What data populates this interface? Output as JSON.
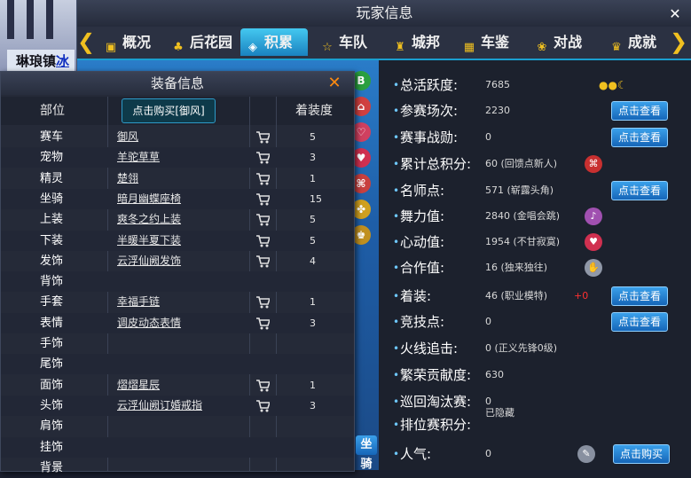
{
  "background": {
    "town_name": "琳琅镇",
    "town_link": "冰"
  },
  "window": {
    "title": "玩家信息",
    "close_glyph": "✕",
    "tabs": [
      {
        "label": "概况",
        "icon": "id-card-icon"
      },
      {
        "label": "后花园",
        "icon": "garden-icon"
      },
      {
        "label": "积累",
        "icon": "layers-icon"
      },
      {
        "label": "车队",
        "icon": "star-icon"
      },
      {
        "label": "城邦",
        "icon": "castle-icon"
      },
      {
        "label": "车鉴",
        "icon": "car-icon"
      },
      {
        "label": "对战",
        "icon": "paw-icon"
      },
      {
        "label": "成就",
        "icon": "medal-icon"
      }
    ],
    "active_tab": "积累",
    "prev_arrow": "❮",
    "next_arrow": "❯"
  },
  "stats": [
    {
      "label": "总活跃度:",
      "value": "7685",
      "extra": "sun-moon-icon"
    },
    {
      "label": "参赛场次:",
      "value": "2230",
      "button": "点击查看"
    },
    {
      "label": "赛事战勋:",
      "value": "0",
      "button": "点击查看"
    },
    {
      "label": "累计总积分:",
      "value": "60 (回馈点新人)",
      "extra": "gift-icon"
    },
    {
      "label": "名师点:",
      "value": "571 (崭露头角)",
      "button": "点击查看"
    },
    {
      "label": "舞力值:",
      "value": "2840 (金唱会跳)",
      "extra": "dance-icon"
    },
    {
      "label": "心动值:",
      "value": "1954 (不甘寂寞)",
      "extra": "heart-icon"
    },
    {
      "label": "合作值:",
      "value": "16 (独来独往)",
      "extra": "handshake-icon"
    },
    {
      "label": "着装:",
      "value": "46 (职业模特)",
      "plus": "+0",
      "button": "点击查看"
    },
    {
      "label": "竞技点:",
      "value": "0",
      "button": "点击查看"
    },
    {
      "label": "火线追击:",
      "value": "0 (正义先锋0级)"
    },
    {
      "label": "繁荣贡献度:",
      "value": "630"
    },
    {
      "label": "巡回淘汰赛:",
      "value": "0"
    },
    {
      "label": "排位赛积分:",
      "value": "已隐藏"
    },
    {
      "label": "人气:",
      "value": "0",
      "extra": "popularity-icon",
      "button": "点击购买"
    }
  ],
  "equipment": {
    "title": "装备信息",
    "close_glyph": "✕",
    "col_slot": "部位",
    "buy_button": "点击购买[御风]",
    "col_count": "着装度",
    "side_button_fragment": "坐骑",
    "rows": [
      {
        "slot": "赛车",
        "item": "御风",
        "count": "5"
      },
      {
        "slot": "宠物",
        "item": "羊驼草草",
        "count": "3"
      },
      {
        "slot": "精灵",
        "item": "楚翎",
        "count": "1"
      },
      {
        "slot": "坐骑",
        "item": "暗月幽蝶座椅",
        "count": "15"
      },
      {
        "slot": "上装",
        "item": "爽冬之约上装",
        "count": "5"
      },
      {
        "slot": "下装",
        "item": "半暖半夏下装",
        "count": "5"
      },
      {
        "slot": "发饰",
        "item": "云浮仙阙发饰",
        "count": "4"
      },
      {
        "slot": "背饰",
        "item": "",
        "count": ""
      },
      {
        "slot": "手套",
        "item": "幸福手链",
        "count": "1"
      },
      {
        "slot": "表情",
        "item": "调皮动态表情",
        "count": "3"
      },
      {
        "slot": "手饰",
        "item": "",
        "count": ""
      },
      {
        "slot": "尾饰",
        "item": "",
        "count": ""
      },
      {
        "slot": "面饰",
        "item": "熠熠星辰",
        "count": "1"
      },
      {
        "slot": "头饰",
        "item": "云浮仙阙订婚戒指",
        "count": "3"
      },
      {
        "slot": "肩饰",
        "item": "",
        "count": ""
      },
      {
        "slot": "挂饰",
        "item": "",
        "count": ""
      },
      {
        "slot": "背景",
        "item": "",
        "count": ""
      }
    ]
  },
  "colors": {
    "accent": "#1a9fd0",
    "button": "#1666b8",
    "plus_text": "#ff3030",
    "close_orange": "#ff8a10"
  }
}
